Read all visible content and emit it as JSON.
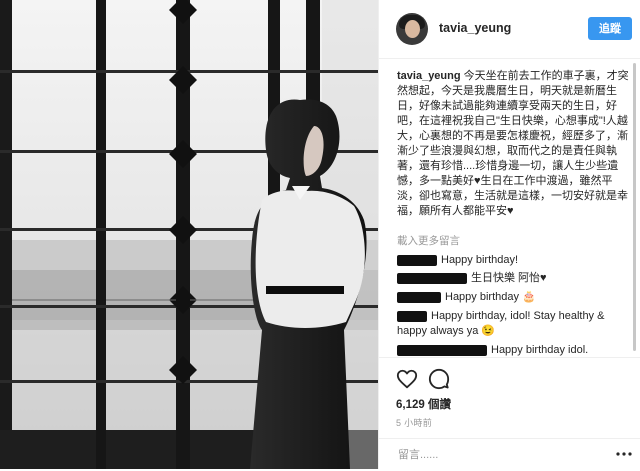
{
  "post": {
    "username": "tavia_yeung",
    "follow_label": "追蹤"
  },
  "caption": {
    "user": "tavia_yeung",
    "text": "今天坐在前去工作的車子裏，才突然想起，今天是我農曆生日，明天就是新曆生日，好像未試過能夠連續享受兩天的生日，好吧，在這裡祝我自己\"生日快樂，心想事成\"!人越大，心裏想的不再是要怎樣慶祝，經歷多了，漸漸少了些浪漫與幻想，取而代之的是責任與執著，還有珍惜....珍惜身邊一切，讓人生少些遺憾，多一點美好♥生日在工作中渡過，雖然平淡，卻也寫意，生活就是這樣，一切安好就是幸福，願所有人都能平安♥"
  },
  "load_more": "載入更多留言",
  "comments": [
    {
      "text": "Happy birthday!"
    },
    {
      "text": "生日快樂 阿怡♥"
    },
    {
      "text": "Happy birthday 🎂"
    },
    {
      "text": "Happy birthday, idol! Stay healthy & happy always ya 😉"
    },
    {
      "text": "Happy birthday idol."
    }
  ],
  "likes": "6,129 個讚",
  "time_ago": "5 小時前",
  "comment_placeholder": "留言......",
  "icons": {
    "like": "heart-icon",
    "comment": "comment-icon",
    "more": "more-options-icon"
  }
}
